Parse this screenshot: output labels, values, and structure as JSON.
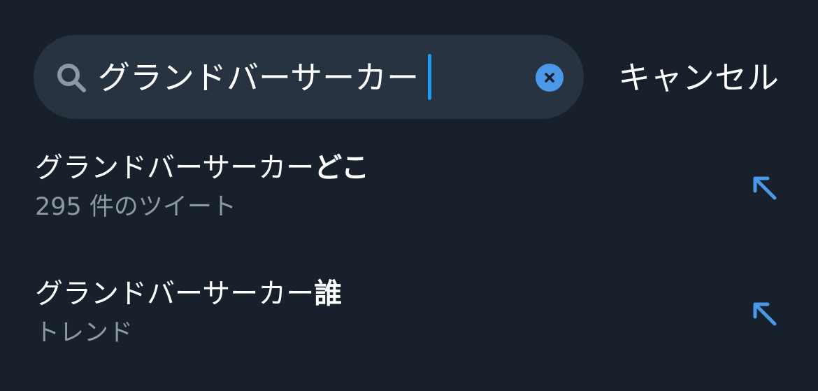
{
  "search": {
    "query": "グランドバーサーカー",
    "cancel_label": "キャンセル",
    "icon": "search-icon",
    "clear_icon": "clear-icon"
  },
  "suggestions": [
    {
      "prefix": "グランドバーサーカー",
      "completion": "どこ",
      "subtitle": "295 件のツイート",
      "icon": "arrow-up-left-icon"
    },
    {
      "prefix": "グランドバーサーカー",
      "completion": "誰",
      "subtitle": "トレンド",
      "icon": "arrow-up-left-icon"
    }
  ],
  "colors": {
    "background": "#17202b",
    "search_field": "#273340",
    "accent": "#4b98e8",
    "caret": "#1d9bf0",
    "secondary_text": "#8b98a5"
  }
}
